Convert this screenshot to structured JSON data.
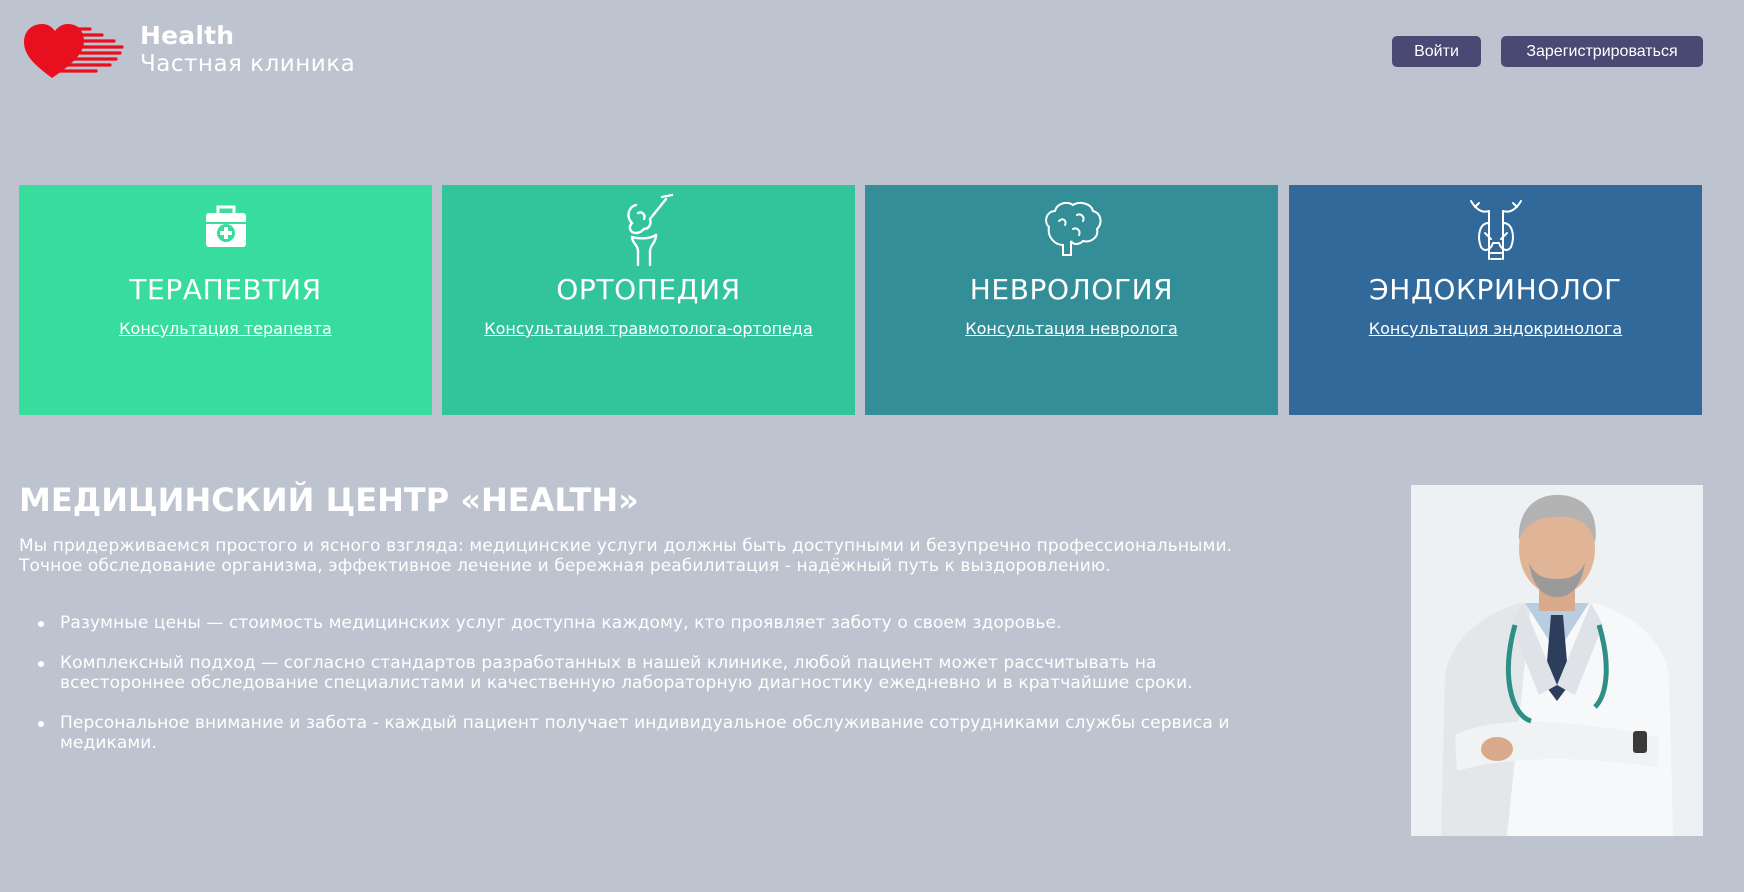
{
  "header": {
    "brand_name": "Health",
    "brand_sub": "Частная клиника",
    "login_label": "Войти",
    "register_label": "Зарегистрироваться"
  },
  "cards": [
    {
      "title": "ТЕРАПЕВТИЯ",
      "link": "Консультация терапевта",
      "color": "#38dd9e",
      "icon": "first-aid-kit-icon"
    },
    {
      "title": "ОРТОПЕДИЯ",
      "link": "Консультация травмотолога-ортопеда",
      "color": "#32c49a",
      "icon": "knee-joint-icon"
    },
    {
      "title": "НЕВРОЛОГИЯ",
      "link": "Консультация невролога",
      "color": "#348e98",
      "icon": "brain-icon"
    },
    {
      "title": "ЭНДОКРИНОЛОГ",
      "link": "Консультация эндокринолога",
      "color": "#31699b",
      "icon": "thyroid-icon"
    }
  ],
  "about": {
    "title": "МЕДИЦИНСКИЙ ЦЕНТР «HEALTH»",
    "intro": "Мы придерживаемся простого и ясного взгляда: медицинские услуги должны быть доступными и безупречно профессиональными. Точное обследование организма, эффективное лечение и бережная реабилитация - надёжный путь к выздоровлению.",
    "bullets": [
      "Разумные цены — стоимость медицинских услуг доступна каждому, кто проявляет заботу о своем здоровье.",
      "Комплексный подход — согласно стандартов разработанных в нашей клинике, любой пациент может рассчитывать на всестороннее обследование специалистами и качественную лабораторную диагностику ежедневно и в кратчайшие сроки.",
      "Персональное внимание и забота - каждый пациент получает индивидуальное обслуживание сотрудниками службы сервиса и медиками."
    ]
  },
  "colors": {
    "background": "#bdc3cf",
    "button": "#4a4974",
    "logo_red": "#e8101e"
  }
}
